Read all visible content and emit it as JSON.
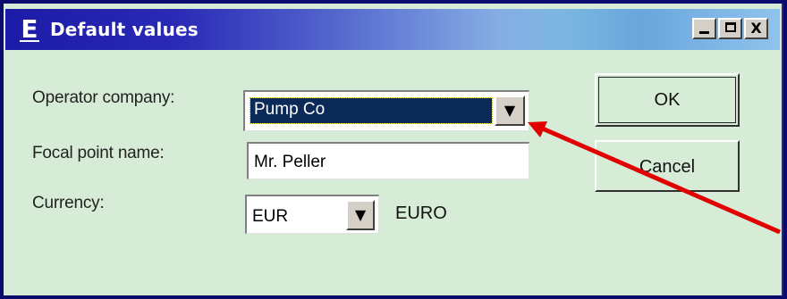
{
  "window": {
    "title": "Default values",
    "title_icon": "E"
  },
  "titlebar_buttons": {
    "minimize": "minimize",
    "maximize": "maximize",
    "close": "X"
  },
  "form": {
    "operator_label": "Operator company:",
    "operator_value": "Pump Co",
    "focal_label": "Focal point name:",
    "focal_value": "Mr. Peller",
    "currency_label": "Currency:",
    "currency_value": "EUR",
    "currency_desc": "EURO"
  },
  "buttons": {
    "ok": "OK",
    "cancel": "Cancel"
  },
  "dropdown_glyph": "▼",
  "colors": {
    "annotation_arrow": "#e00000",
    "selection": "#0c2a58",
    "dialog_bg": "#d6ecd6"
  }
}
